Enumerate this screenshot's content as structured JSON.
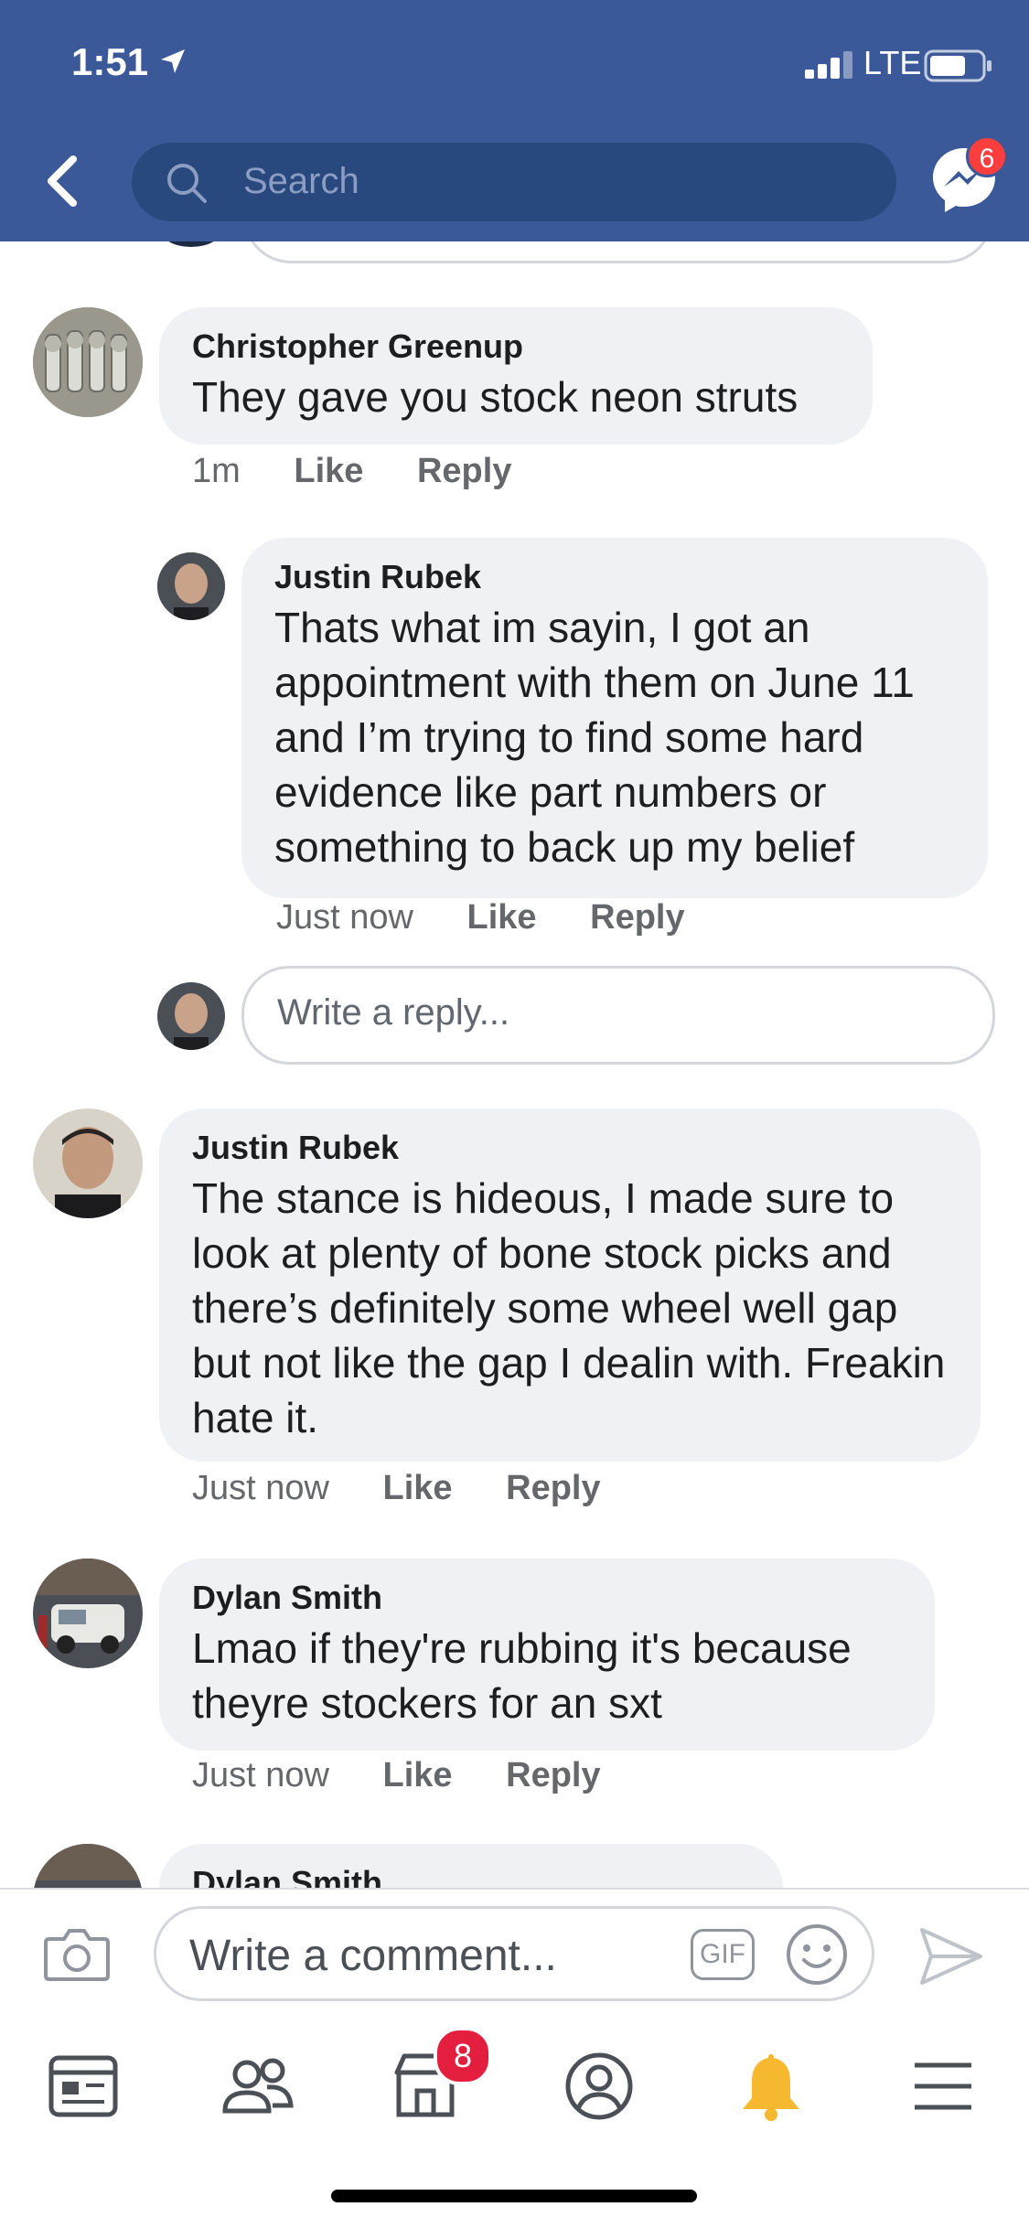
{
  "status_bar": {
    "time": "1:51",
    "network": "LTE"
  },
  "header": {
    "search_placeholder": "Search",
    "messenger_badge": "6"
  },
  "comments": [
    {
      "author": "Christopher Greenup",
      "text": "They gave you stock neon struts",
      "time": "1m",
      "like": "Like",
      "reply": "Reply"
    },
    {
      "author": "Justin Rubek",
      "text": "Thats what im sayin, I got an appointment with them on June 11 and I’m trying to find some hard evidence like part numbers or something to back up my belief",
      "time": "Just now",
      "like": "Like",
      "reply": "Reply"
    },
    {
      "author": "Justin Rubek",
      "text": "The stance is hideous, I made sure to look at plenty of bone stock picks and there’s definitely some wheel well gap but not like the gap I dealin with. Freakin hate it.",
      "time": "Just now",
      "like": "Like",
      "reply": "Reply"
    },
    {
      "author": "Dylan Smith",
      "text": "Lmao if they're rubbing it's because theyre stockers for an sxt",
      "time": "Just now",
      "like": "Like",
      "reply": "Reply"
    },
    {
      "author": "Dylan Smith"
    }
  ],
  "reply_input": {
    "placeholder": "Write a reply..."
  },
  "composer": {
    "placeholder": "Write a comment...",
    "gif_label": "GIF"
  },
  "tabbar": {
    "marketplace_badge": "8"
  },
  "icons": [
    "location-arrow-icon",
    "signal-icon",
    "battery-icon",
    "back-icon",
    "search-icon",
    "messenger-icon",
    "camera-icon",
    "emoji-icon",
    "send-icon",
    "news-feed-icon",
    "friends-icon",
    "marketplace-icon",
    "profile-icon",
    "notifications-icon",
    "menu-icon"
  ],
  "colors": {
    "brand": "#3b5998",
    "badge": "#fa3e3e",
    "bell": "#f5b82e"
  }
}
